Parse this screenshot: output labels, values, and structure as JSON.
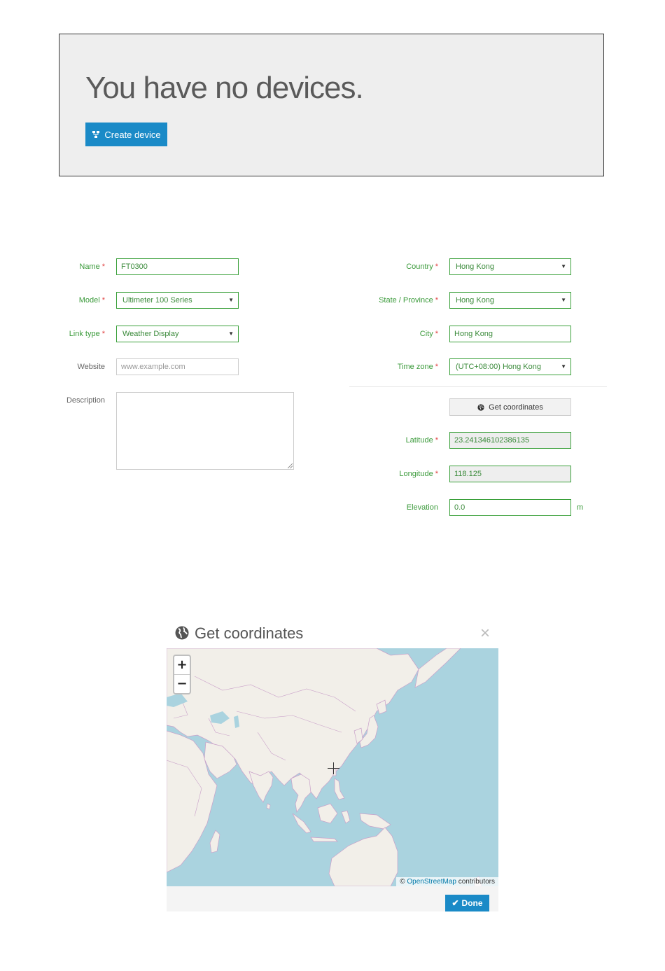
{
  "empty_state": {
    "heading": "You have no devices.",
    "create_button": "Create device"
  },
  "form": {
    "left": {
      "name": {
        "label": "Name",
        "required": "*",
        "value": "FT0300"
      },
      "model": {
        "label": "Model",
        "required": "*",
        "value": "Ultimeter 100 Series"
      },
      "link_type": {
        "label": "Link type",
        "required": "*",
        "value": "Weather Display"
      },
      "website": {
        "label": "Website",
        "placeholder": "www.example.com"
      },
      "description": {
        "label": "Description"
      }
    },
    "right": {
      "country": {
        "label": "Country",
        "required": "*",
        "value": "Hong Kong"
      },
      "state": {
        "label": "State / Province",
        "required": "*",
        "value": "Hong Kong"
      },
      "city": {
        "label": "City",
        "required": "*",
        "value": "Hong Kong"
      },
      "timezone": {
        "label": "Time zone",
        "required": "*",
        "value": "(UTC+08:00) Hong Kong"
      },
      "get_coordinates_button": "Get coordinates",
      "latitude": {
        "label": "Latitude",
        "required": "*",
        "value": "23.241346102386135"
      },
      "longitude": {
        "label": "Longitude",
        "required": "*",
        "value": "118.125"
      },
      "elevation": {
        "label": "Elevation",
        "value": "0.0",
        "unit": "m"
      }
    }
  },
  "modal": {
    "title": "Get coordinates",
    "close": "×",
    "zoom_in": "+",
    "zoom_out": "−",
    "attribution_prefix": "©",
    "attribution_link": "OpenStreetMap",
    "attribution_suffix": "contributors",
    "done_button": "Done"
  },
  "colors": {
    "primary": "#1a8ac7",
    "field_border": "#3aa03a",
    "required": "#e04040",
    "map_water": "#aad3df",
    "map_land": "#f2efe9",
    "map_border": "#c9a0c9"
  }
}
